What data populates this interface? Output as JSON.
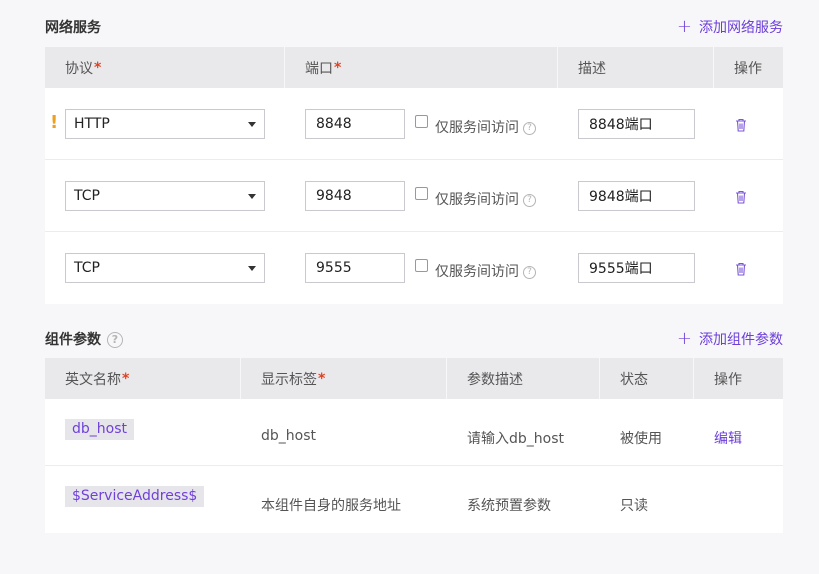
{
  "network": {
    "title": "网络服务",
    "add_label": "添加网络服务",
    "headers": {
      "protocol": "协议",
      "port": "端口",
      "desc": "描述",
      "action": "操作"
    },
    "required_mark": "*",
    "checkbox_label": "仅服务间访问",
    "rows": [
      {
        "protocol": "HTTP",
        "port": "8848",
        "desc": "8848端口",
        "warning": "!"
      },
      {
        "protocol": "TCP",
        "port": "9848",
        "desc": "9848端口"
      },
      {
        "protocol": "TCP",
        "port": "9555",
        "desc": "9555端口"
      }
    ]
  },
  "params": {
    "title": "组件参数",
    "add_label": "添加组件参数",
    "headers": {
      "name": "英文名称",
      "label": "显示标签",
      "desc": "参数描述",
      "status": "状态",
      "action": "操作"
    },
    "rows": [
      {
        "name": "db_host",
        "label": "db_host",
        "desc": "请输入db_host",
        "status": "被使用",
        "action": "编辑"
      },
      {
        "name": "$ServiceAddress$",
        "label": "本组件自身的服务地址",
        "desc": "系统预置参数",
        "status": "只读"
      }
    ]
  },
  "colors": {
    "accent": "#6c3fd8",
    "required": "#e0411f",
    "warning": "#f0a020"
  }
}
